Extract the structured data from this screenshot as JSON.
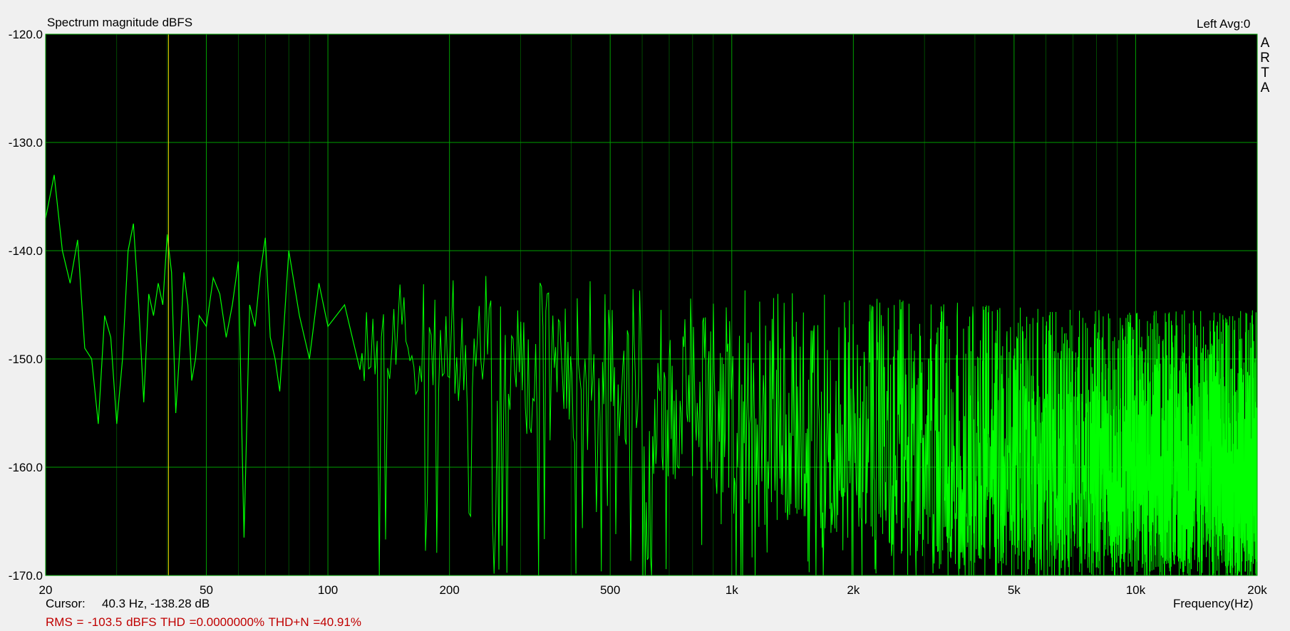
{
  "window": {
    "title": "Spectrum magnitude dBFS",
    "channel_info": "Left  Avg:0",
    "brand_mark": "ARTA"
  },
  "status": {
    "cursor_label": "Cursor:",
    "cursor_value": "40.3 Hz, -138.28 dB",
    "rms_stats": "RMS = -103.5 dBFS   THD =0.0000000%   THD+N =40.91%"
  },
  "colors": {
    "plot_background": "#000000",
    "grid": "#00a000",
    "trace": "#00ff00",
    "cursor": "#d4c400",
    "stats_text": "#c00000"
  },
  "chart_data": {
    "type": "line",
    "title": "Spectrum magnitude dBFS",
    "xlabel": "Frequency(Hz)",
    "ylabel": "",
    "xscale": "log",
    "xlim": [
      20,
      20000
    ],
    "ylim": [
      -170,
      -120
    ],
    "grid": true,
    "y_ticks": [
      {
        "value": -120,
        "label": "-120.0"
      },
      {
        "value": -130,
        "label": "-130.0"
      },
      {
        "value": -140,
        "label": "-140.0"
      },
      {
        "value": -150,
        "label": "-150.0"
      },
      {
        "value": -160,
        "label": "-160.0"
      },
      {
        "value": -170,
        "label": "-170.0"
      }
    ],
    "x_ticks": [
      {
        "value": 20,
        "label": "20"
      },
      {
        "value": 50,
        "label": "50"
      },
      {
        "value": 100,
        "label": "100"
      },
      {
        "value": 200,
        "label": "200"
      },
      {
        "value": 500,
        "label": "500"
      },
      {
        "value": 1000,
        "label": "1k"
      },
      {
        "value": 2000,
        "label": "2k"
      },
      {
        "value": 5000,
        "label": "5k"
      },
      {
        "value": 10000,
        "label": "10k"
      },
      {
        "value": 20000,
        "label": "20k"
      }
    ],
    "x_minor_grid": [
      30,
      40,
      60,
      70,
      80,
      90,
      300,
      400,
      600,
      700,
      800,
      900,
      3000,
      4000,
      6000,
      7000,
      8000,
      9000
    ],
    "cursor_x": 40.3,
    "series": [
      {
        "x": [
          20,
          21,
          22,
          23,
          24,
          25,
          26,
          27,
          28,
          29,
          30,
          31,
          32,
          33,
          34,
          35,
          36,
          37,
          38,
          39,
          40,
          41,
          42,
          43,
          44,
          45,
          46,
          47,
          48,
          50,
          52,
          54,
          56,
          58,
          60,
          62,
          64,
          66,
          68,
          70,
          72,
          74,
          76,
          80,
          85,
          90,
          95,
          100,
          110,
          120
        ],
        "y": [
          -137,
          -133,
          -140,
          -143,
          -139,
          -149,
          -150,
          -156,
          -146,
          -148,
          -156,
          -150,
          -140,
          -137.5,
          -145,
          -154,
          -144,
          -146,
          -143,
          -145,
          -138.5,
          -142,
          -155,
          -149,
          -142,
          -145,
          -152,
          -150,
          -146,
          -147,
          -142.5,
          -144,
          -148,
          -145,
          -141,
          -166.5,
          -145,
          -147,
          -142,
          -138.8,
          -148,
          -150,
          -153,
          -140,
          -146,
          -150,
          -143,
          -147,
          -145,
          -151
        ]
      }
    ]
  }
}
